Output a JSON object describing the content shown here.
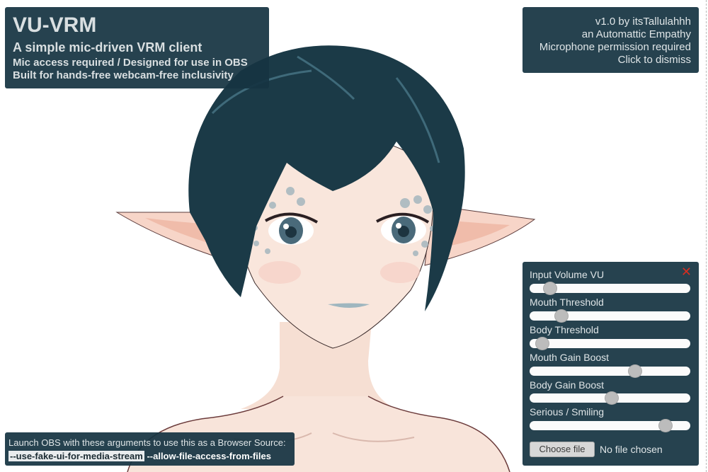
{
  "title_panel": {
    "title": "VU-VRM",
    "subtitle": "A simple mic-driven VRM client",
    "line1": "Mic access required / Designed for use in OBS",
    "line2": "Built for hands-free webcam-free inclusivity"
  },
  "about_panel": {
    "version": "v1.0 by itsTallulahhh",
    "company": "an Automattic Empathy",
    "permission": "Microphone permission required",
    "dismiss": "Click to dismiss"
  },
  "controls": {
    "close_glyph": "✕",
    "sliders": [
      {
        "label": "Input Volume VU",
        "value": 0.09
      },
      {
        "label": "Mouth Threshold",
        "value": 0.17
      },
      {
        "label": "Body Threshold",
        "value": 0.04
      },
      {
        "label": "Mouth Gain Boost",
        "value": 0.67
      },
      {
        "label": "Body Gain Boost",
        "value": 0.51
      },
      {
        "label": "Serious / Smiling",
        "value": 0.88
      }
    ],
    "file_button": "Choose file",
    "file_status": "No file chosen"
  },
  "obs": {
    "message": "Launch OBS with these arguments to use this as a Browser Source:",
    "arg1": "--use-fake-ui-for-media-stream",
    "arg2": " --allow-file-access-from-files"
  },
  "colors": {
    "panel_bg": "#163442",
    "hair": "#1b3a47",
    "skin": "#f9e6dc",
    "close_red": "#d62d20"
  },
  "icons": {
    "close": "close-icon"
  }
}
